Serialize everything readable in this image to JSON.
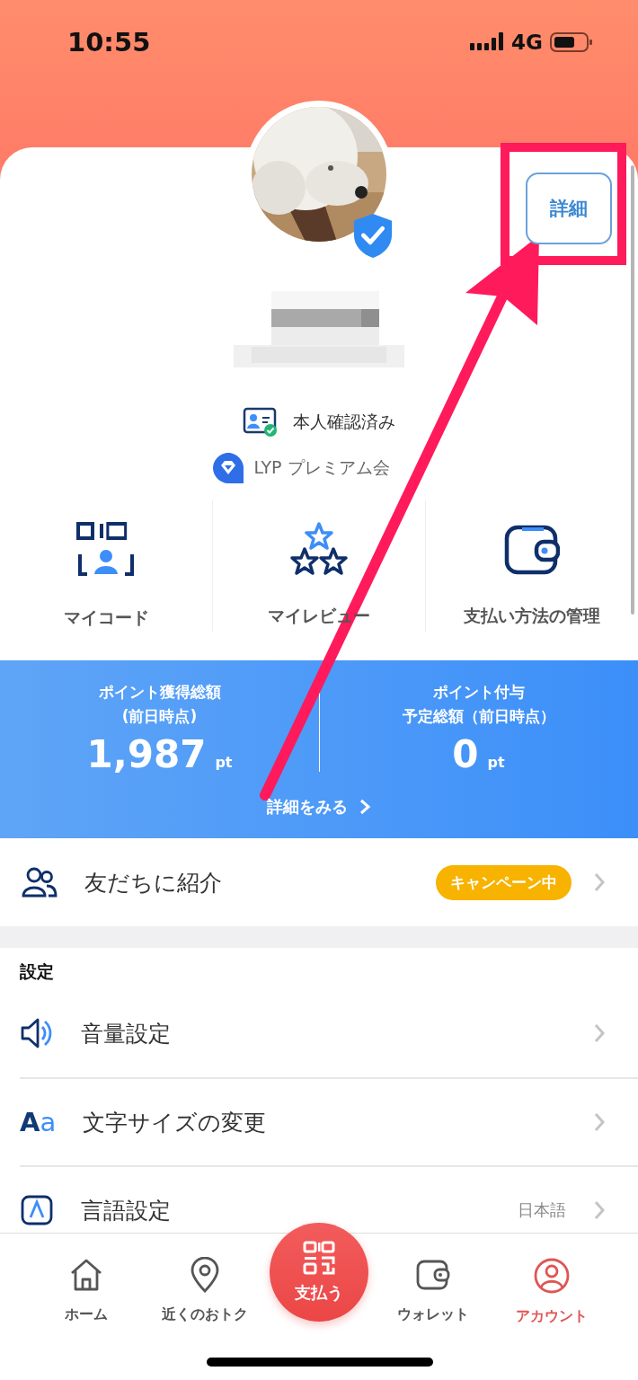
{
  "status_bar": {
    "time": "10:55",
    "network": "4G"
  },
  "profile": {
    "details_button": "詳細",
    "verified_label": "本人確認済み",
    "membership": "LYP プレミアム会"
  },
  "shortcuts": [
    {
      "label": "マイコード",
      "kind": "code"
    },
    {
      "label": "マイレビュー",
      "kind": "review"
    },
    {
      "label": "支払い方法の管理",
      "kind": "wallet"
    }
  ],
  "points": {
    "items": [
      {
        "title_lines": [
          "ポイント獲得総額",
          "(前日時点)"
        ],
        "value": "1,987",
        "unit": "pt"
      },
      {
        "title_lines": [
          "ポイント付与",
          "予定総額（前日時点）"
        ],
        "value": "0",
        "unit": "pt"
      }
    ],
    "link": "詳細をみる"
  },
  "referral": {
    "label": "友だちに紹介",
    "badge": "キャンペーン中"
  },
  "settings": {
    "title": "設定",
    "rows": [
      {
        "label": "音量設定",
        "kind": "volume"
      },
      {
        "label": "文字サイズの変更",
        "kind": "text-size",
        "icon_text": "Aa"
      },
      {
        "label": "言語設定",
        "kind": "language",
        "value": "日本語"
      }
    ]
  },
  "nav": [
    {
      "label": "ホーム",
      "kind": "home",
      "selected": false
    },
    {
      "label": "近くのおトク",
      "kind": "pin",
      "selected": false
    },
    {
      "label": "支払う",
      "kind": "pay",
      "selected": false
    },
    {
      "label": "ウォレット",
      "kind": "wallet",
      "selected": false
    },
    {
      "label": "アカウント",
      "kind": "account",
      "selected": true
    }
  ]
}
